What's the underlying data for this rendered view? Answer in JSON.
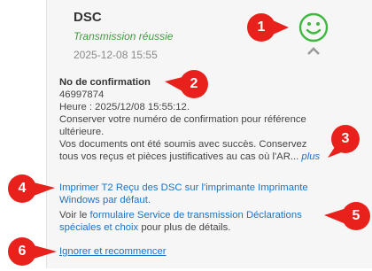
{
  "header": {
    "title": "DSC",
    "status": "Transmission réussie",
    "timestamp": "2025-12-08 15:55"
  },
  "confirmation": {
    "heading": "No de confirmation",
    "number": "46997874",
    "time": "Heure : 2025/12/08 15:55:12.",
    "keep_line1": "Conserver votre numéro de confirmation pour référence",
    "keep_line2": "ultérieure.",
    "docs_line1": "Vos documents ont été soumis avec succès. Conservez",
    "docs_line2": "tous vos reçus et pièces justificatives au cas où l'AR...",
    "more": "plus"
  },
  "actions": {
    "print_link_line1": "Imprimer T2 Reçu des DSC sur l'imprimante Imprimante",
    "print_link_line2": "Windows par défaut.",
    "see_prefix": "Voir le",
    "form_link_line1": "formulaire Service de transmission Déclarations",
    "form_link_line2": "spéciales et choix",
    "see_suffix": "pour plus de détails.",
    "ignore_link": "Ignorer et recommencer"
  },
  "callouts": [
    "1",
    "2",
    "3",
    "4",
    "5",
    "6"
  ],
  "colors": {
    "callout_red": "#e8211c",
    "success_green": "#3fb83f",
    "link_blue": "#1a73c7"
  },
  "icons": {
    "status": "smiley-success-icon",
    "collapse": "chevron-up-icon"
  }
}
